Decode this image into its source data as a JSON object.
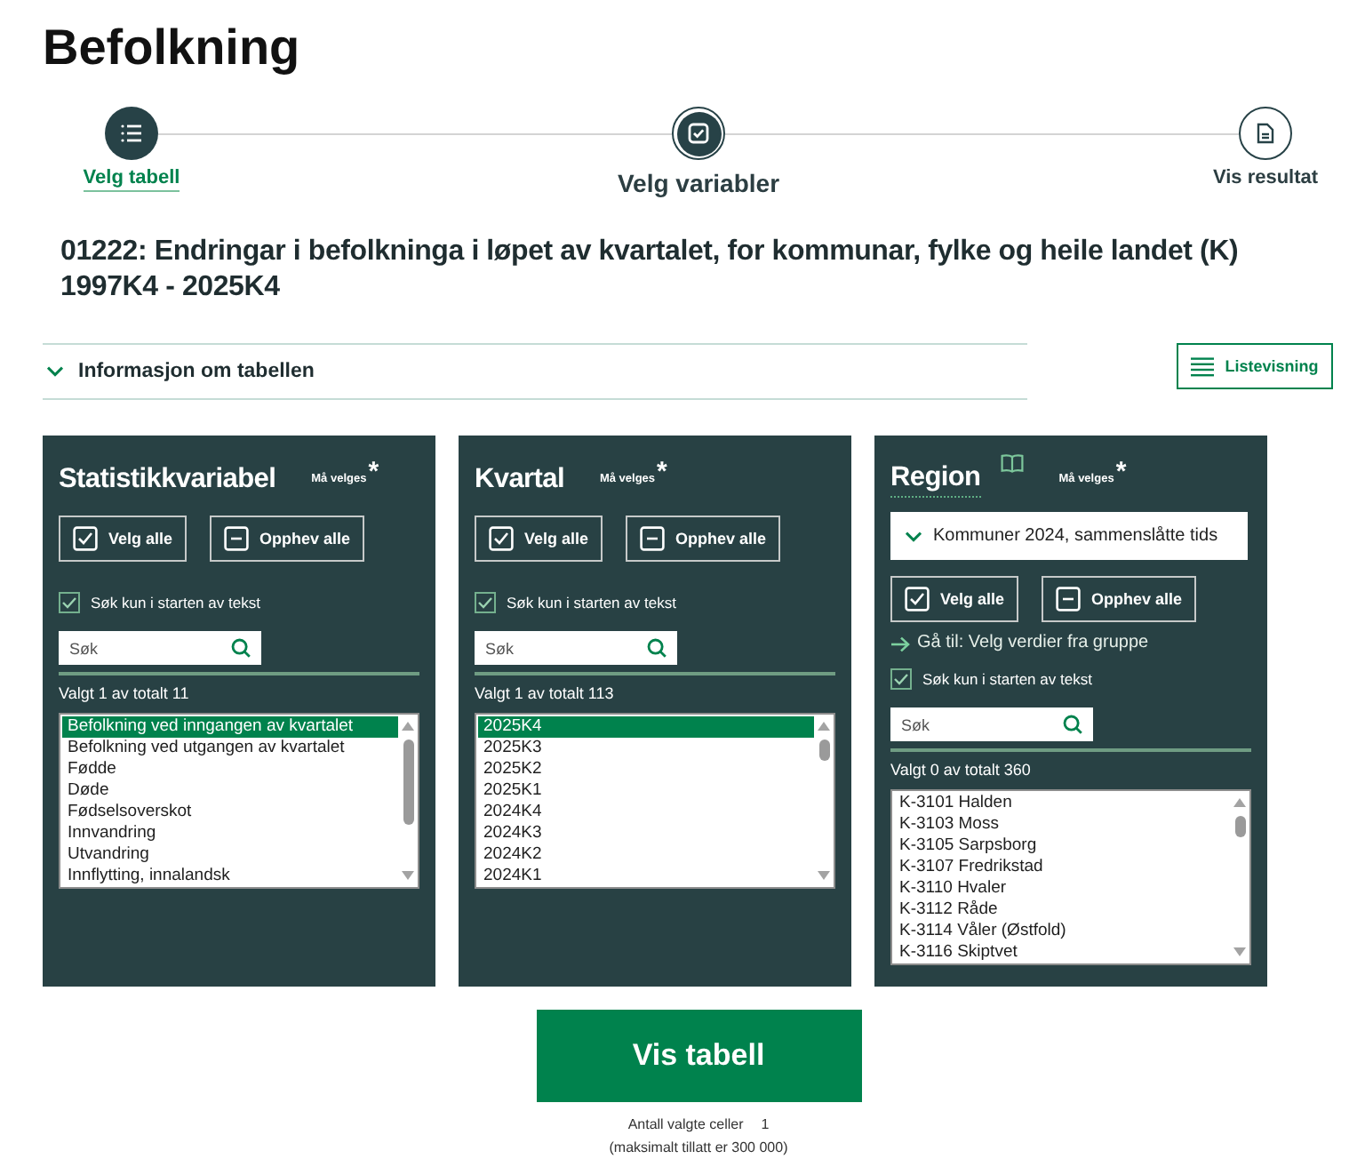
{
  "page_title": "Befolkning",
  "steps": [
    {
      "label": "Velg tabell",
      "completed": true,
      "selected": false
    },
    {
      "label": "Velg variabler",
      "completed": false,
      "selected": true
    },
    {
      "label": "Vis resultat",
      "completed": false,
      "selected": false
    }
  ],
  "table_heading": "01222: Endringar i befolkninga i løpet av kvartalet, for kommunar, fylke og heile landet (K) 1997K4 - 2025K4",
  "info_accordion": {
    "label": "Informasjon om tabellen",
    "expanded": false
  },
  "view_toggle": {
    "label": "Listevisning"
  },
  "variables": [
    {
      "title": "Statistikkvariabel",
      "note": false,
      "required_label": "Må velges",
      "required_mark": "*",
      "select_all": "Velg alle",
      "deselect_all": "Opphev alle",
      "search_start_only": {
        "label": "Søk kun i starten av tekst",
        "checked": true
      },
      "search": {
        "placeholder": "Søk"
      },
      "count": "Valgt 1 av totalt 11",
      "values": [
        {
          "label": "Befolkning ved inngangen av kvartalet",
          "selected": true
        },
        {
          "label": "Befolkning ved utgangen av kvartalet",
          "selected": false
        },
        {
          "label": "Fødde",
          "selected": false
        },
        {
          "label": "Døde",
          "selected": false
        },
        {
          "label": "Fødselsoverskot",
          "selected": false
        },
        {
          "label": "Innvandring",
          "selected": false
        },
        {
          "label": "Utvandring",
          "selected": false
        },
        {
          "label": "Innflytting, innalandsk",
          "selected": false
        }
      ]
    },
    {
      "title": "Kvartal",
      "note": false,
      "required_label": "Må velges",
      "required_mark": "*",
      "select_all": "Velg alle",
      "deselect_all": "Opphev alle",
      "search_start_only": {
        "label": "Søk kun i starten av tekst",
        "checked": true
      },
      "search": {
        "placeholder": "Søk"
      },
      "count": "Valgt 1 av totalt 113",
      "values": [
        {
          "label": "2025K4",
          "selected": true
        },
        {
          "label": "2025K3",
          "selected": false
        },
        {
          "label": "2025K2",
          "selected": false
        },
        {
          "label": "2025K1",
          "selected": false
        },
        {
          "label": "2024K4",
          "selected": false
        },
        {
          "label": "2024K3",
          "selected": false
        },
        {
          "label": "2024K2",
          "selected": false
        },
        {
          "label": "2024K1",
          "selected": false
        }
      ]
    },
    {
      "title": "Region",
      "note": true,
      "required_label": "Må velges",
      "required_mark": "*",
      "codelist": "Kommuner 2024, sammenslåtte tids",
      "select_all": "Velg alle",
      "deselect_all": "Opphev alle",
      "goto_link": "Gå til: Velg verdier fra gruppe",
      "search_start_only": {
        "label": "Søk kun i starten av tekst",
        "checked": true
      },
      "search": {
        "placeholder": "Søk"
      },
      "count": "Valgt 0 av totalt 360",
      "values": [
        {
          "label": "K-3101 Halden",
          "selected": false
        },
        {
          "label": "K-3103 Moss",
          "selected": false
        },
        {
          "label": "K-3105 Sarpsborg",
          "selected": false
        },
        {
          "label": "K-3107 Fredrikstad",
          "selected": false
        },
        {
          "label": "K-3110 Hvaler",
          "selected": false
        },
        {
          "label": "K-3112 Råde",
          "selected": false
        },
        {
          "label": "K-3114 Våler (Østfold)",
          "selected": false
        },
        {
          "label": "K-3116 Skiptvet",
          "selected": false
        }
      ]
    }
  ],
  "show_table_button": "Vis tabell",
  "cell_count": {
    "label": "Antall valgte celler",
    "value": "1"
  },
  "max_note": "(maksimalt tillatt er 300 000)"
}
